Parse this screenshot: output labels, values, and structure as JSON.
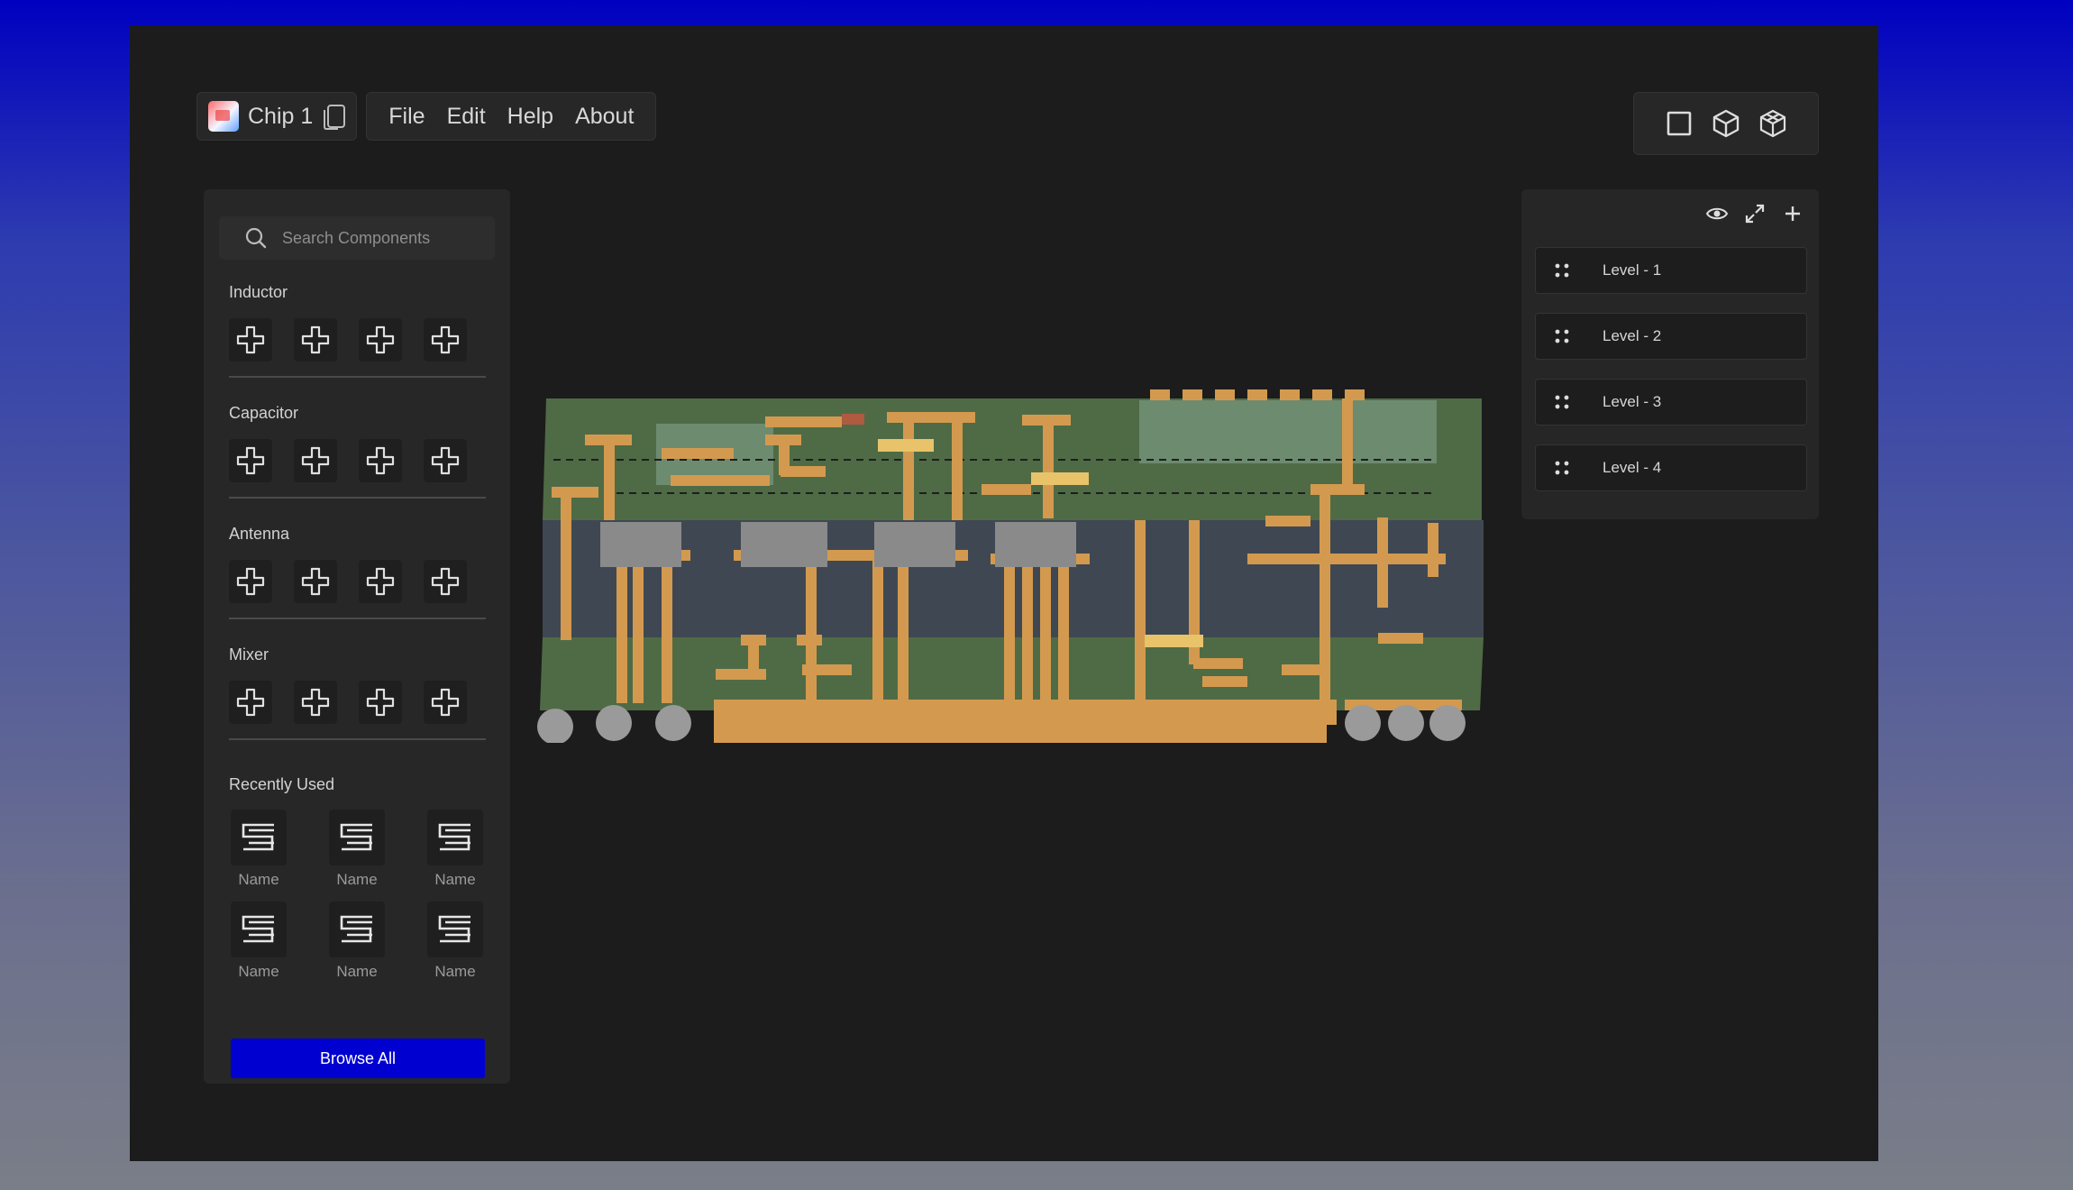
{
  "window": {
    "project_name": "Chip 1",
    "menu": [
      "File",
      "Edit",
      "Help",
      "About"
    ]
  },
  "view_modes": [
    "2d-square-icon",
    "3d-cube-icon",
    "3d-cube-wire-icon"
  ],
  "left_panel": {
    "search_placeholder": "Search Components",
    "categories": [
      {
        "title": "Inductor"
      },
      {
        "title": "Capacitor"
      },
      {
        "title": "Antenna"
      },
      {
        "title": "Mixer"
      }
    ],
    "recent_title": "Recently Used",
    "recent_items": [
      "Name",
      "Name",
      "Name",
      "Name",
      "Name",
      "Name"
    ],
    "browse_label": "Browse All"
  },
  "right_panel": {
    "tools": [
      "eye-icon",
      "expand-icon",
      "plus-icon"
    ],
    "levels": [
      "Level - 1",
      "Level - 2",
      "Level - 3",
      "Level - 4"
    ]
  },
  "colors": {
    "accent": "#0000d0",
    "app_bg": "#1c1c1c",
    "panel_bg": "#272727",
    "pcb_green": "#4f6b45",
    "pcb_slate": "#3f4852",
    "copper": "#d39a4f"
  }
}
